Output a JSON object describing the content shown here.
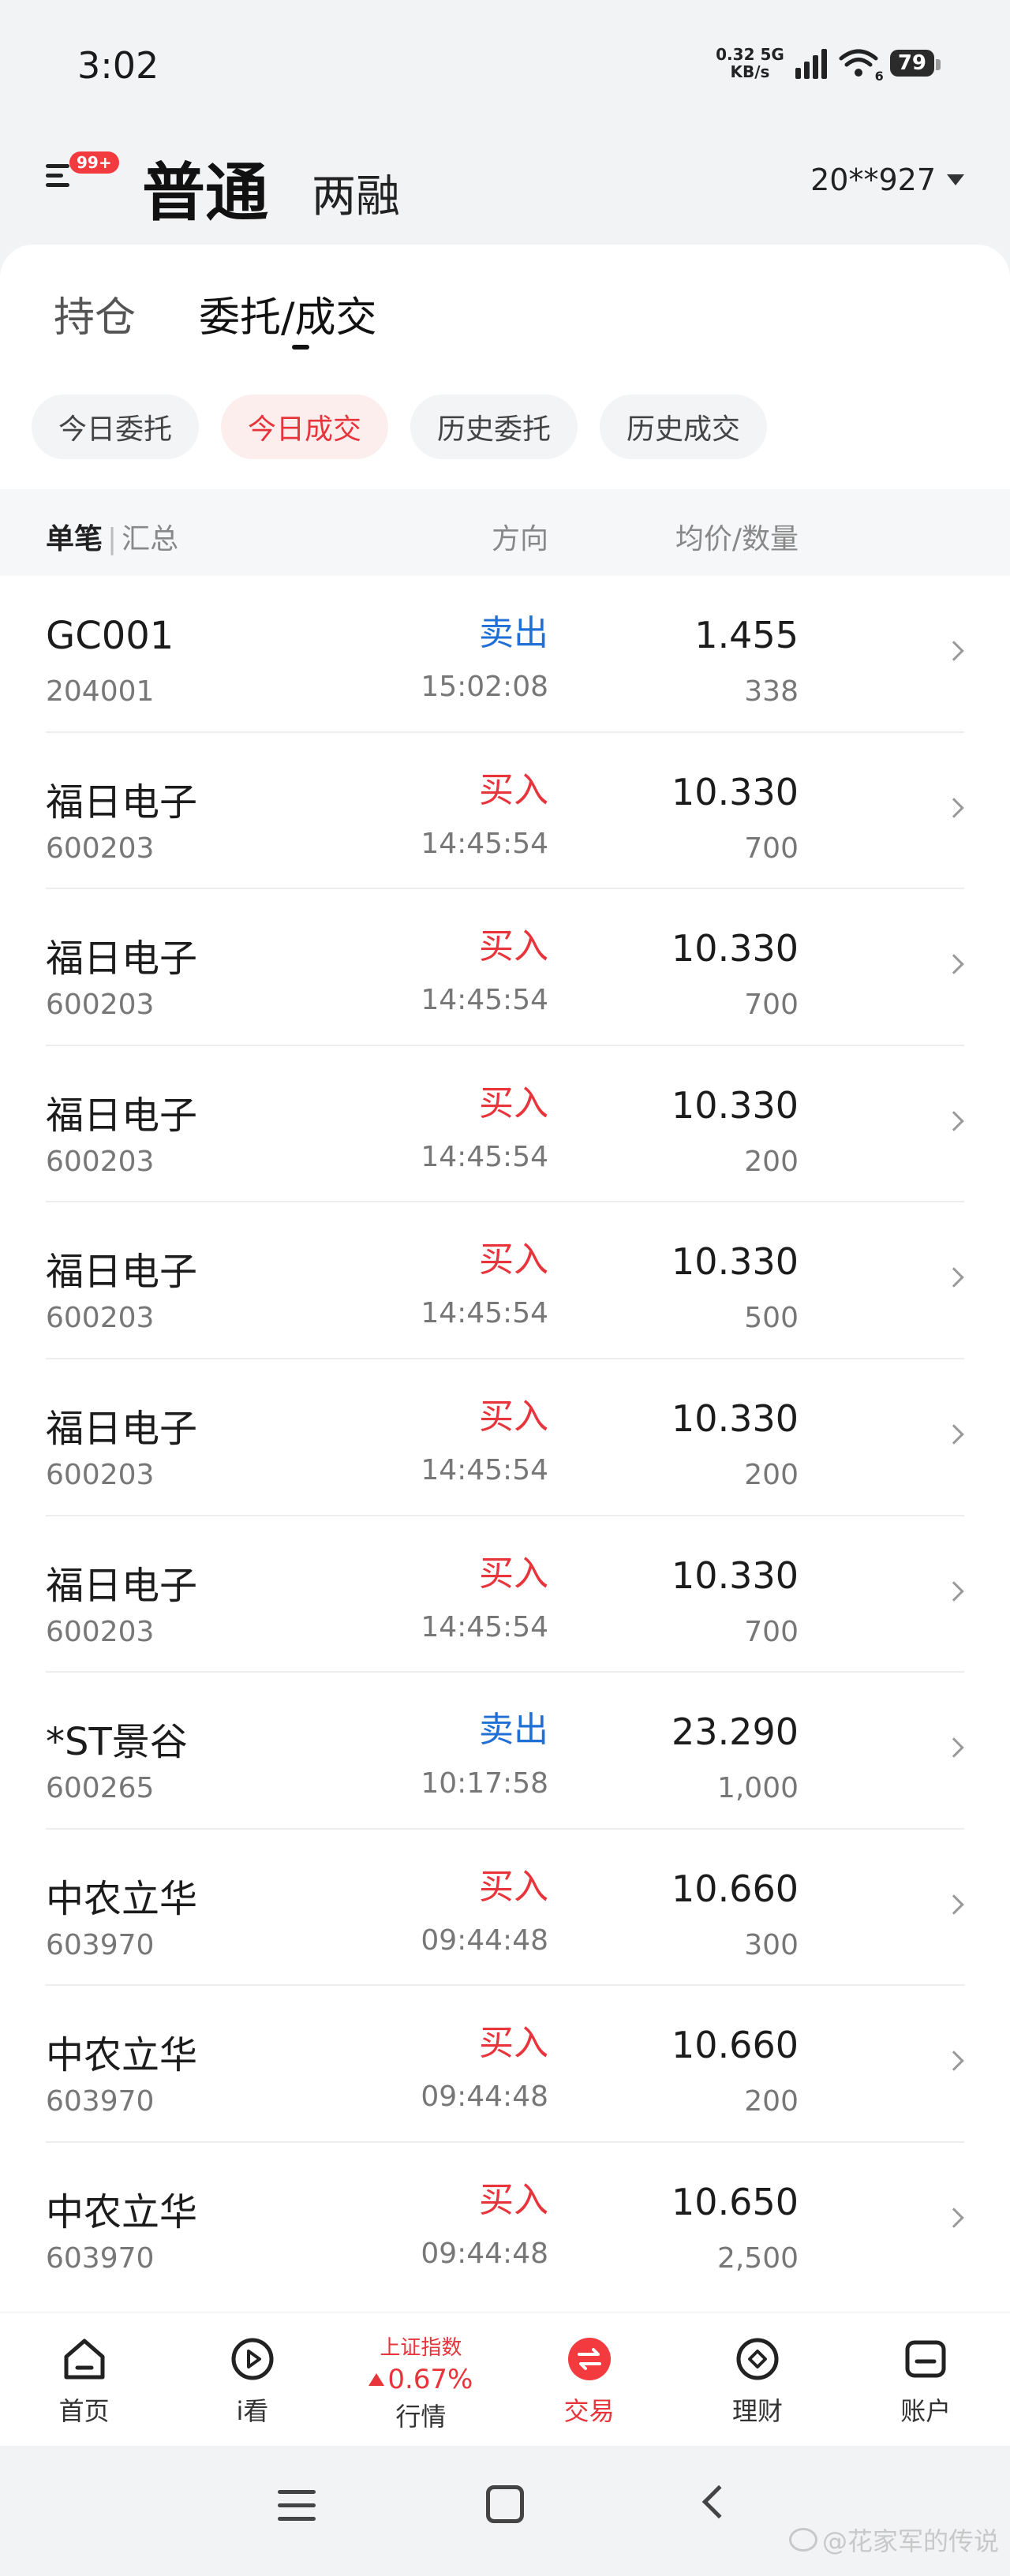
{
  "status_bar": {
    "time": "3:02",
    "net_speed_value": "0.32",
    "net_speed_unit": "KB/s",
    "network_type": "5G",
    "wifi_label": "6",
    "battery": "79"
  },
  "header": {
    "badge": "99+",
    "mode_active": "普通",
    "mode_inactive": "两融",
    "account": "20**927"
  },
  "top_tabs": [
    "持仓",
    "委托/成交"
  ],
  "chips": [
    {
      "label": "今日委托",
      "active": false
    },
    {
      "label": "今日成交",
      "active": true
    },
    {
      "label": "历史委托",
      "active": false
    },
    {
      "label": "历史成交",
      "active": false
    }
  ],
  "table_head": {
    "single": "单笔",
    "separator": "|",
    "summary": "汇总",
    "direction": "方向",
    "price_qty": "均价/数量"
  },
  "rows": [
    {
      "name": "GC001",
      "code": "204001",
      "direction": "卖出",
      "type": "sell",
      "time": "15:02:08",
      "price": "1.455",
      "qty": "338"
    },
    {
      "name": "福日电子",
      "code": "600203",
      "direction": "买入",
      "type": "buy",
      "time": "14:45:54",
      "price": "10.330",
      "qty": "700"
    },
    {
      "name": "福日电子",
      "code": "600203",
      "direction": "买入",
      "type": "buy",
      "time": "14:45:54",
      "price": "10.330",
      "qty": "700"
    },
    {
      "name": "福日电子",
      "code": "600203",
      "direction": "买入",
      "type": "buy",
      "time": "14:45:54",
      "price": "10.330",
      "qty": "200"
    },
    {
      "name": "福日电子",
      "code": "600203",
      "direction": "买入",
      "type": "buy",
      "time": "14:45:54",
      "price": "10.330",
      "qty": "500"
    },
    {
      "name": "福日电子",
      "code": "600203",
      "direction": "买入",
      "type": "buy",
      "time": "14:45:54",
      "price": "10.330",
      "qty": "200"
    },
    {
      "name": "福日电子",
      "code": "600203",
      "direction": "买入",
      "type": "buy",
      "time": "14:45:54",
      "price": "10.330",
      "qty": "700"
    },
    {
      "name": "*ST景谷",
      "code": "600265",
      "direction": "卖出",
      "type": "sell",
      "time": "10:17:58",
      "price": "23.290",
      "qty": "1,000"
    },
    {
      "name": "中农立华",
      "code": "603970",
      "direction": "买入",
      "type": "buy",
      "time": "09:44:48",
      "price": "10.660",
      "qty": "300"
    },
    {
      "name": "中农立华",
      "code": "603970",
      "direction": "买入",
      "type": "buy",
      "time": "09:44:48",
      "price": "10.660",
      "qty": "200"
    },
    {
      "name": "中农立华",
      "code": "603970",
      "direction": "买入",
      "type": "buy",
      "time": "09:44:48",
      "price": "10.650",
      "qty": "2,500"
    }
  ],
  "bottom_nav": {
    "home": "首页",
    "watch": "i看",
    "market_title": "上证指数",
    "market_value": "0.67%",
    "market": "行情",
    "trade": "交易",
    "finance": "理财",
    "account": "账户"
  },
  "watermark": "@花家军的传说",
  "colors": {
    "buy": "#e8343b",
    "sell": "#1f6fd6",
    "accent": "#f23a3f"
  },
  "icons": [
    "menu-icon",
    "caret-down-icon",
    "chevron-right-icon",
    "home-icon",
    "play-icon",
    "trade-icon",
    "finance-icon",
    "account-icon"
  ]
}
